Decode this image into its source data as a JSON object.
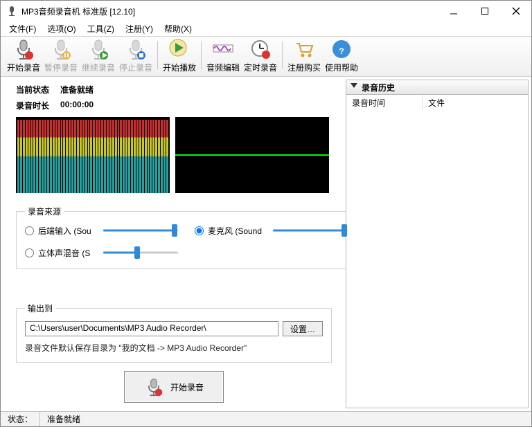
{
  "window": {
    "title": "MP3音频录音机 标准版 [12.10]"
  },
  "menu": {
    "file": "文件(F)",
    "options": "选项(O)",
    "tools": "工具(Z)",
    "register": "注册(Y)",
    "help": "帮助(X)"
  },
  "toolbar": {
    "start_rec": "开始录音",
    "pause_rec": "暂停录音",
    "resume_rec": "继续录音",
    "stop_rec": "停止录音",
    "play": "开始播放",
    "edit": "音频编辑",
    "timer": "定时录音",
    "buy": "注册购买",
    "help": "使用帮助"
  },
  "status": {
    "label": "当前状态",
    "value": "准备就绪",
    "time_label": "录音时长",
    "time_value": "00:00:00"
  },
  "source": {
    "legend": "录音来源",
    "opt_rear": "后端输入 (Sou",
    "opt_mix": "立体声混音 (S",
    "opt_mic": "麦克风 (Sound",
    "selected": "mic",
    "sliders": {
      "rear": 95,
      "mix": 45,
      "mic": 95
    }
  },
  "output": {
    "legend": "输出到",
    "path": "C:\\Users\\user\\Documents\\MP3 Audio Recorder\\",
    "settings_btn": "设置…",
    "hint": "录音文件默认保存目录为 \"我的文档 -> MP3 Audio Recorder\""
  },
  "main_button": "开始录音",
  "history": {
    "title": "录音历史",
    "col_time": "录音时间",
    "col_file": "文件"
  },
  "statusbar": {
    "label": "状态：",
    "value": "准备就绪"
  },
  "icons": {
    "mic": "mic-icon",
    "play": "play-icon",
    "wave": "waveform-icon",
    "clock": "clock-icon",
    "cart": "cart-icon",
    "help": "help-icon",
    "gear": "gear-icon"
  }
}
